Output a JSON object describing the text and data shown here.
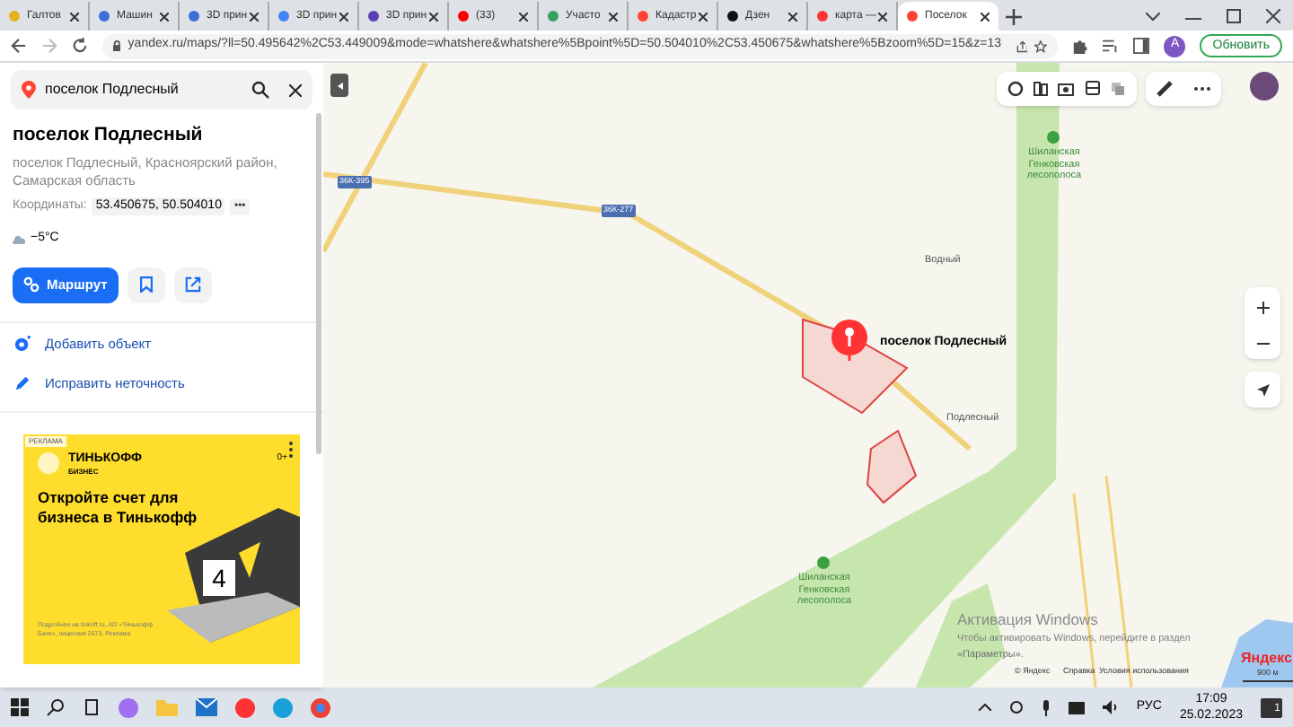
{
  "browser": {
    "tabs": [
      {
        "label": "Галтов",
        "selected": false
      },
      {
        "label": "Машин",
        "selected": false
      },
      {
        "label": "3D прин",
        "selected": false
      },
      {
        "label": "3D прин",
        "selected": false
      },
      {
        "label": "3D прин",
        "selected": false
      },
      {
        "label": "(33)",
        "selected": false
      },
      {
        "label": "Участо",
        "selected": false
      },
      {
        "label": "Кадастр",
        "selected": false
      },
      {
        "label": "Дзен",
        "selected": false
      },
      {
        "label": "карта —",
        "selected": false
      },
      {
        "label": "Поселок",
        "selected": true
      }
    ],
    "url": "yandex.ru/maps/?ll=50.495642%2C53.449009&mode=whatshere&whatshere%5Bpoint%5D=50.504010%2C53.450675&whatshere%5Bzoom%5D=15&z=13",
    "profile": "A",
    "update_button": "Обновить"
  },
  "panel": {
    "search": {
      "value": "поселок Подлесный"
    },
    "title": "поселок Подлесный",
    "address": "поселок Подлесный, Красноярский район, Самарская область",
    "coordinates_label": "Координаты:",
    "coordinates": "53.450675, 50.504010",
    "more": "•••",
    "weather": "−5°C",
    "route_button": "Маршрут",
    "actions": [
      "Добавить объект",
      "Исправить неточность"
    ],
    "ad": {
      "badge": "РЕКЛАМА",
      "brand": "ТИНЬКОФФ",
      "brand_sub": "БИЗНЕС",
      "headline": "Откройте счет для бизнеса в Тинькофф",
      "calendar": "4",
      "age": "0+",
      "fine_print": "Подробнее на tinkoff.ru, АО «Тинькофф Банк», лицензия 2673. Реклама"
    }
  },
  "map": {
    "road_labels": [
      "36К-395",
      "36К-277"
    ],
    "places": [
      {
        "label": "Водный",
        "kind": "village"
      },
      {
        "label": "Подлесный",
        "kind": "village"
      },
      {
        "label": "Шиланская Генковская лесополоса",
        "kind": "forest"
      },
      {
        "label": "Шиланская Генковская лесополоса",
        "kind": "forest"
      }
    ],
    "pin_label": "поселок Подлесный",
    "attribution": [
      "© Яндекс",
      "Справка",
      "Условия использования"
    ],
    "scale": "900 м",
    "logo": "Яндекс",
    "activation": {
      "title": "Активация Windows",
      "text": "Чтобы активировать Windows, перейдите в раздел",
      "text2": "«Параметры»."
    }
  },
  "taskbar": {
    "language": "РУС",
    "time": "17:09",
    "date": "25.02.2023",
    "notifications": "1"
  }
}
